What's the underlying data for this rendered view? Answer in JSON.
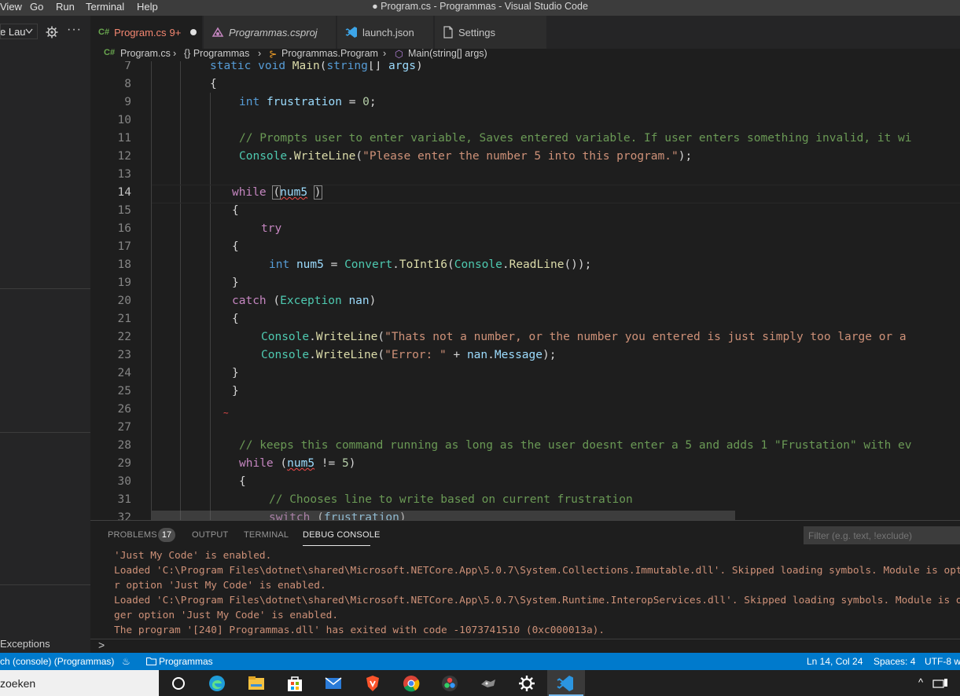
{
  "window": {
    "title": "● Program.cs - Programmas - Visual Studio Code",
    "menu": [
      "View",
      "Go",
      "Run",
      "Terminal",
      "Help"
    ]
  },
  "sidebar": {
    "launch_config": "e Lau",
    "exceptions_label": "Exceptions"
  },
  "tabs": [
    {
      "icon": "C#",
      "label": "Program.cs",
      "badge": "9+",
      "active": true,
      "modified": true
    },
    {
      "label": "Programmas.csproj",
      "italic": true
    },
    {
      "label": "launch.json"
    },
    {
      "label": "Settings"
    }
  ],
  "breadcrumb": {
    "file_icon": "C#",
    "file": "Program.cs",
    "namespace": "{} Programmas",
    "class": "Programmas.Program",
    "method": "Main(string[] args)"
  },
  "editor": {
    "line_numbers": [
      "7",
      "8",
      "9",
      "10",
      "11",
      "12",
      "13",
      "14",
      "15",
      "16",
      "17",
      "18",
      "19",
      "20",
      "21",
      "22",
      "23",
      "24",
      "25",
      "26",
      "27",
      "28",
      "29",
      "30",
      "31",
      "32"
    ],
    "current_line": "14"
  },
  "panel": {
    "tabs": [
      "PROBLEMS",
      "OUTPUT",
      "TERMINAL",
      "DEBUG CONSOLE"
    ],
    "problems_count": "17",
    "active_tab": "DEBUG CONSOLE",
    "filter_placeholder": "Filter (e.g. text, !exclude)",
    "console_lines": [
      "'Just My Code' is enabled.",
      "Loaded 'C:\\Program Files\\dotnet\\shared\\Microsoft.NETCore.App\\5.0.7\\System.Collections.Immutable.dll'. Skipped loading symbols. Module is opt",
      "r option 'Just My Code' is enabled.",
      "Loaded 'C:\\Program Files\\dotnet\\shared\\Microsoft.NETCore.App\\5.0.7\\System.Runtime.InteropServices.dll'. Skipped loading symbols. Module is o",
      "ger option 'Just My Code' is enabled.",
      "The program '[240] Programmas.dll' has exited with code -1073741510 (0xc000013a)."
    ],
    "prompt": ">"
  },
  "statusbar": {
    "debug_config": "ch (console) (Programmas)",
    "project": "Programmas",
    "position": "Ln 14, Col 24",
    "spaces": "Spaces: 4",
    "encoding": "UTF-8 wi"
  },
  "taskbar": {
    "search_text": "zoeken"
  },
  "colors": {
    "accent": "#007acc",
    "modified_tab_text": "#f48771",
    "string": "#ce9178",
    "keyword": "#569cd6",
    "comment": "#6a9955"
  }
}
